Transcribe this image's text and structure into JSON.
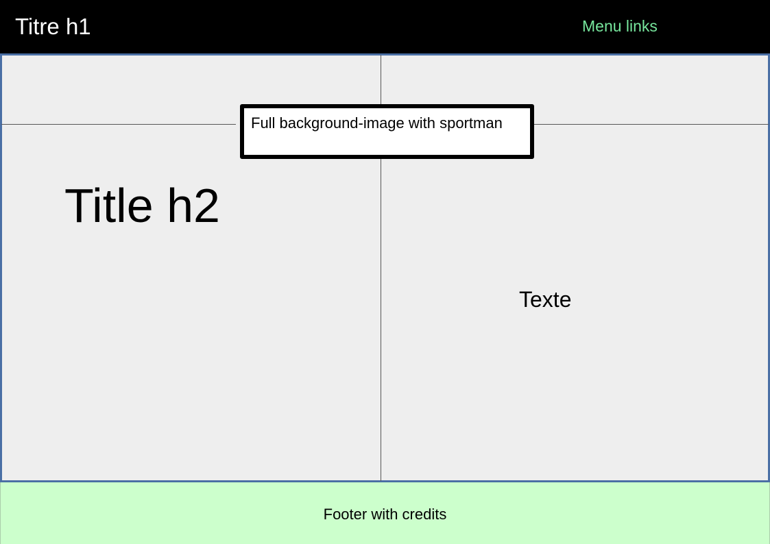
{
  "header": {
    "title": "Titre h1",
    "menu_label": "Menu links",
    "background_color": "#000000",
    "menu_color": "#77e69d"
  },
  "main": {
    "background_note": "Full background-image with sportman",
    "title": "Title h2",
    "text": "Texte",
    "background_color": "#eeeeee",
    "border_color": "#4a6fa5"
  },
  "footer": {
    "text": "Footer with credits",
    "background_color": "#ccffcc"
  }
}
